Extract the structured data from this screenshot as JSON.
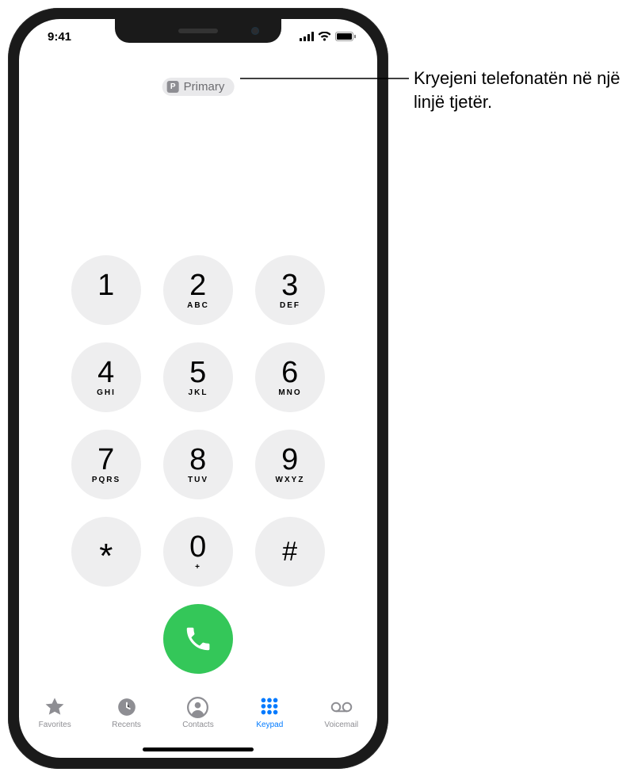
{
  "status": {
    "time": "9:41"
  },
  "line_selector": {
    "badge": "P",
    "label": "Primary"
  },
  "keypad": [
    {
      "digit": "1",
      "letters": ""
    },
    {
      "digit": "2",
      "letters": "ABC"
    },
    {
      "digit": "3",
      "letters": "DEF"
    },
    {
      "digit": "4",
      "letters": "GHI"
    },
    {
      "digit": "5",
      "letters": "JKL"
    },
    {
      "digit": "6",
      "letters": "MNO"
    },
    {
      "digit": "7",
      "letters": "PQRS"
    },
    {
      "digit": "8",
      "letters": "TUV"
    },
    {
      "digit": "9",
      "letters": "WXYZ"
    },
    {
      "digit": "*",
      "letters": ""
    },
    {
      "digit": "0",
      "letters": "+"
    },
    {
      "digit": "#",
      "letters": ""
    }
  ],
  "tabs": [
    {
      "id": "favorites",
      "label": "Favorites",
      "active": false
    },
    {
      "id": "recents",
      "label": "Recents",
      "active": false
    },
    {
      "id": "contacts",
      "label": "Contacts",
      "active": false
    },
    {
      "id": "keypad",
      "label": "Keypad",
      "active": true
    },
    {
      "id": "voicemail",
      "label": "Voicemail",
      "active": false
    }
  ],
  "callout": {
    "text": "Kryejeni telefonatën në një linjë tjetër."
  }
}
